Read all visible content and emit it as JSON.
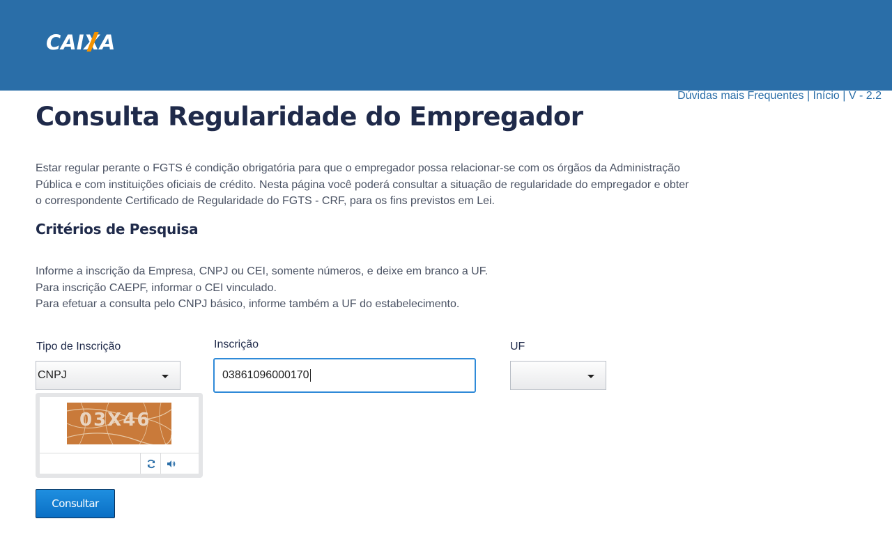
{
  "header": {
    "logo_text": "CAIXA",
    "brand_color": "#2a6ea8",
    "accent_color": "#f39200"
  },
  "toplinks": {
    "faq": "Dúvidas mais Frequentes",
    "separator": "|",
    "home": "Início",
    "version": "V - 2.2"
  },
  "page": {
    "title": "Consulta Regularidade do Empregador",
    "intro_lines": [
      "Estar regular perante o FGTS é condição obrigatória para que o empregador possa relacionar-se com os órgãos da Administração",
      "Pública e com instituições oficiais de crédito. Nesta página você poderá consultar a situação de regularidade do empregador e obter",
      "o correspondente Certificado de Regularidade do FGTS - CRF, para os fins previstos em Lei."
    ],
    "section_title": "Critérios de Pesquisa",
    "instructions": [
      "Informe a inscrição da Empresa, CNPJ ou CEI, somente números, e deixe em branco a UF.",
      "Para inscrição CAEPF, informar o CEI vinculado.",
      "Para efetuar a consulta pelo CNPJ básico, informe também a UF do estabelecimento."
    ]
  },
  "form": {
    "tipo_label": "Tipo de Inscrição",
    "tipo_value": "CNPJ",
    "inscricao_label": "Inscrição",
    "inscricao_value": "03861096000170",
    "uf_label": "UF",
    "uf_value": "",
    "captcha_text": "03X46",
    "captcha_input": "",
    "refresh_icon": "refresh-icon",
    "audio_icon": "speaker-icon",
    "submit_label": "Consultar"
  }
}
